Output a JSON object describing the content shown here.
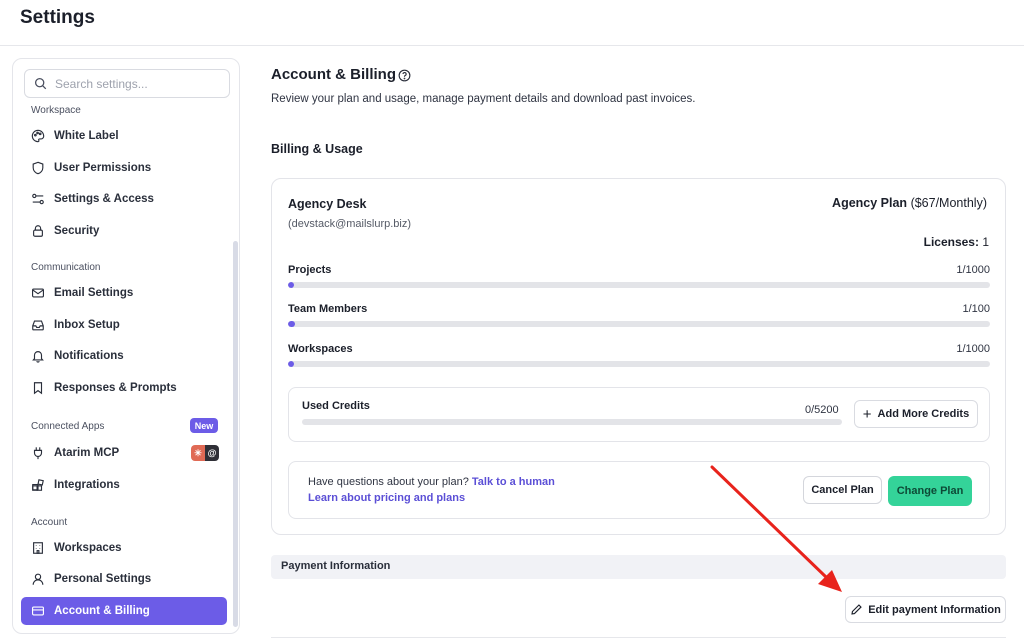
{
  "header": {
    "title": "Settings"
  },
  "search": {
    "placeholder": "Search settings..."
  },
  "sidebar": {
    "sections": [
      {
        "label": "Workspace"
      },
      {
        "label": "Communication"
      },
      {
        "label": "Connected Apps",
        "badge": "New"
      },
      {
        "label": "Account"
      }
    ],
    "items": [
      {
        "label": "White Label",
        "icon": "palette-icon"
      },
      {
        "label": "User Permissions",
        "icon": "shield-icon"
      },
      {
        "label": "Settings & Access",
        "icon": "sliders-icon"
      },
      {
        "label": "Security",
        "icon": "lock-icon"
      },
      {
        "label": "Email Settings",
        "icon": "mail-icon"
      },
      {
        "label": "Inbox Setup",
        "icon": "inbox-icon"
      },
      {
        "label": "Notifications",
        "icon": "bell-icon"
      },
      {
        "label": "Responses & Prompts",
        "icon": "bookmark-icon"
      },
      {
        "label": "Atarim MCP",
        "icon": "plug-icon"
      },
      {
        "label": "Integrations",
        "icon": "blocks-icon"
      },
      {
        "label": "Workspaces",
        "icon": "building-icon"
      },
      {
        "label": "Personal Settings",
        "icon": "user-icon"
      },
      {
        "label": "Account & Billing",
        "icon": "card-icon",
        "active": true
      }
    ]
  },
  "main": {
    "title": "Account & Billing",
    "description": "Review your plan and usage, manage payment details and download past invoices.",
    "billing_heading": "Billing & Usage",
    "account": {
      "name": "Agency Desk",
      "email": "(devstack@mailslurp.biz)",
      "plan_name": "Agency Plan",
      "plan_price": "($67/Monthly)",
      "licenses_label": "Licenses:",
      "licenses_value": "1"
    },
    "usage": [
      {
        "label": "Projects",
        "count": "1/1000",
        "fraction": 0.001
      },
      {
        "label": "Team Members",
        "count": "1/100",
        "fraction": 0.01
      },
      {
        "label": "Workspaces",
        "count": "1/1000",
        "fraction": 0.001
      }
    ],
    "credits": {
      "label": "Used Credits",
      "count": "0/5200",
      "fraction": 0,
      "button": "Add More Credits"
    },
    "help": {
      "question": "Have questions about your plan?",
      "talk_link": "Talk to a human",
      "learn_link": "Learn about pricing and plans",
      "cancel_button": "Cancel Plan",
      "change_button": "Change Plan"
    },
    "payment": {
      "heading": "Payment Information",
      "edit_button": "Edit payment Information"
    }
  },
  "colors": {
    "accent": "#6c5ce7",
    "success": "#34d399",
    "annotation_arrow": "#e8231c"
  }
}
